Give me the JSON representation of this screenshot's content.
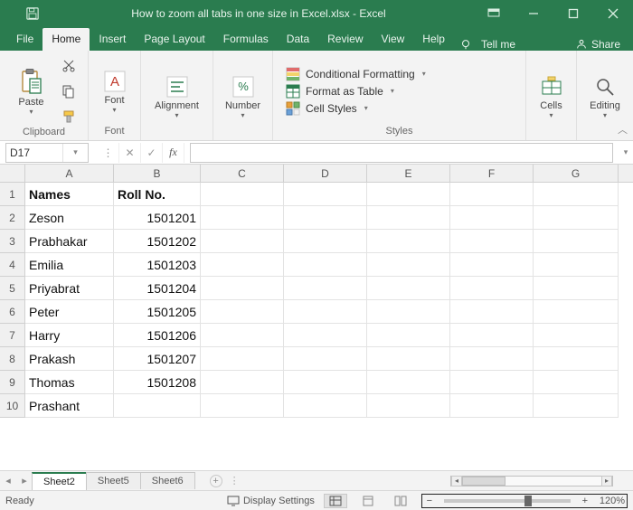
{
  "window": {
    "title": "How to zoom all tabs in one size in Excel.xlsx  -  Excel"
  },
  "ribbon": {
    "tabs": [
      "File",
      "Home",
      "Insert",
      "Page Layout",
      "Formulas",
      "Data",
      "Review",
      "View",
      "Help"
    ],
    "active_tab": "Home",
    "tell_me": "Tell me",
    "share": "Share",
    "groups": {
      "clipboard": {
        "label": "Clipboard",
        "paste": "Paste"
      },
      "font": {
        "label": "Font",
        "btn": "Font"
      },
      "alignment": {
        "label": "",
        "btn": "Alignment"
      },
      "number": {
        "label": "",
        "btn": "Number"
      },
      "styles": {
        "label": "Styles",
        "cond_fmt": "Conditional Formatting",
        "as_table": "Format as Table",
        "cell_styles": "Cell Styles"
      },
      "cells": {
        "label": "",
        "btn": "Cells"
      },
      "editing": {
        "label": "",
        "btn": "Editing"
      }
    }
  },
  "formula_bar": {
    "name_box": "D17",
    "fx_label": "fx",
    "value": ""
  },
  "grid": {
    "columns": [
      "A",
      "B",
      "C",
      "D",
      "E",
      "F",
      "G"
    ],
    "rows": [
      {
        "n": 1,
        "A": "Names",
        "B": "Roll No.",
        "header": true
      },
      {
        "n": 2,
        "A": "Zeson",
        "B": "1501201"
      },
      {
        "n": 3,
        "A": "Prabhakar",
        "B": "1501202"
      },
      {
        "n": 4,
        "A": "Emilia",
        "B": "1501203"
      },
      {
        "n": 5,
        "A": "Priyabrat",
        "B": "1501204"
      },
      {
        "n": 6,
        "A": "Peter",
        "B": "1501205"
      },
      {
        "n": 7,
        "A": "Harry",
        "B": "1501206"
      },
      {
        "n": 8,
        "A": "Prakash",
        "B": "1501207"
      },
      {
        "n": 9,
        "A": "Thomas",
        "B": "1501208"
      },
      {
        "n": 10,
        "A": "Prashant",
        "B": ""
      }
    ]
  },
  "sheet_tabs": {
    "tabs": [
      "Sheet2",
      "Sheet5",
      "Sheet6"
    ],
    "active": "Sheet2"
  },
  "status": {
    "mode": "Ready",
    "display_settings": "Display Settings",
    "zoom": "120%"
  }
}
